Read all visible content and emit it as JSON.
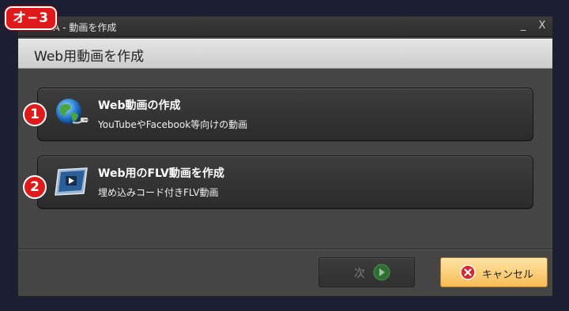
{
  "annotation_label": "オ−3",
  "window": {
    "title": "BA - 動画を作成",
    "minimize_symbol": "_",
    "close_symbol": "X"
  },
  "header": {
    "title": "Web用動画を作成"
  },
  "options": [
    {
      "badge": "1",
      "title": "Web動画の作成",
      "subtitle": "YouTubeやFacebook等向けの動画",
      "icon": "globe-icon"
    },
    {
      "badge": "2",
      "title": "Web用のFLV動画を作成",
      "subtitle": "埋め込みコード付きFLV動画",
      "icon": "video-screen-icon"
    }
  ],
  "footer": {
    "next_label": "次",
    "next_icon": "arrow-right-icon",
    "cancel_label": "キャンセル",
    "cancel_icon": "cancel-x-icon"
  },
  "colors": {
    "annotation_red": "#e0191b",
    "background": "#1c1e33",
    "dialog_body": "#454545",
    "cancel_orange": "#f7bd55",
    "next_arrow_green": "#3a8a3a"
  }
}
